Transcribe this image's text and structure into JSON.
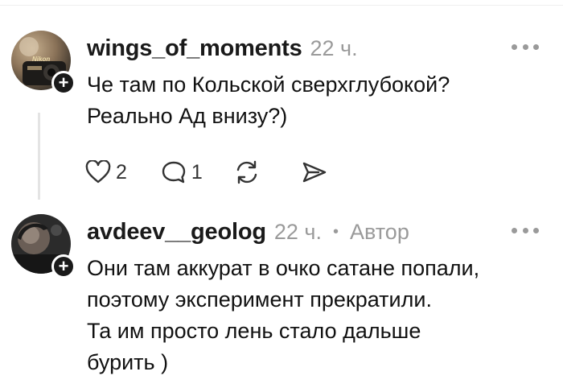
{
  "comments": [
    {
      "username": "wings_of_moments",
      "time": "22 ч.",
      "text_lines": [
        "Че там по Кольской сверхглубокой?",
        "Реально Ад внизу?)"
      ],
      "likes": "2",
      "replies": "1",
      "avatar_text": "Nikon"
    },
    {
      "username": "avdeev__geolog",
      "time": "22 ч.",
      "separator": "•",
      "author_label": "Автор",
      "text_lines": [
        "Они там аккурат в очко сатане попали,",
        "поэтому эксперимент прекратили.",
        "Та им просто лень стало дальше",
        "бурить )"
      ]
    }
  ],
  "icons": {
    "more": "more-dots-icon",
    "follow": "plus-icon",
    "like": "heart-icon",
    "reply": "comment-bubble-icon",
    "repost": "repost-icon",
    "share": "send-icon"
  },
  "colors": {
    "text": "#111111",
    "muted": "#9a9a9a",
    "badge": "#1a1a1a",
    "thread_line": "#e4e4e4"
  }
}
